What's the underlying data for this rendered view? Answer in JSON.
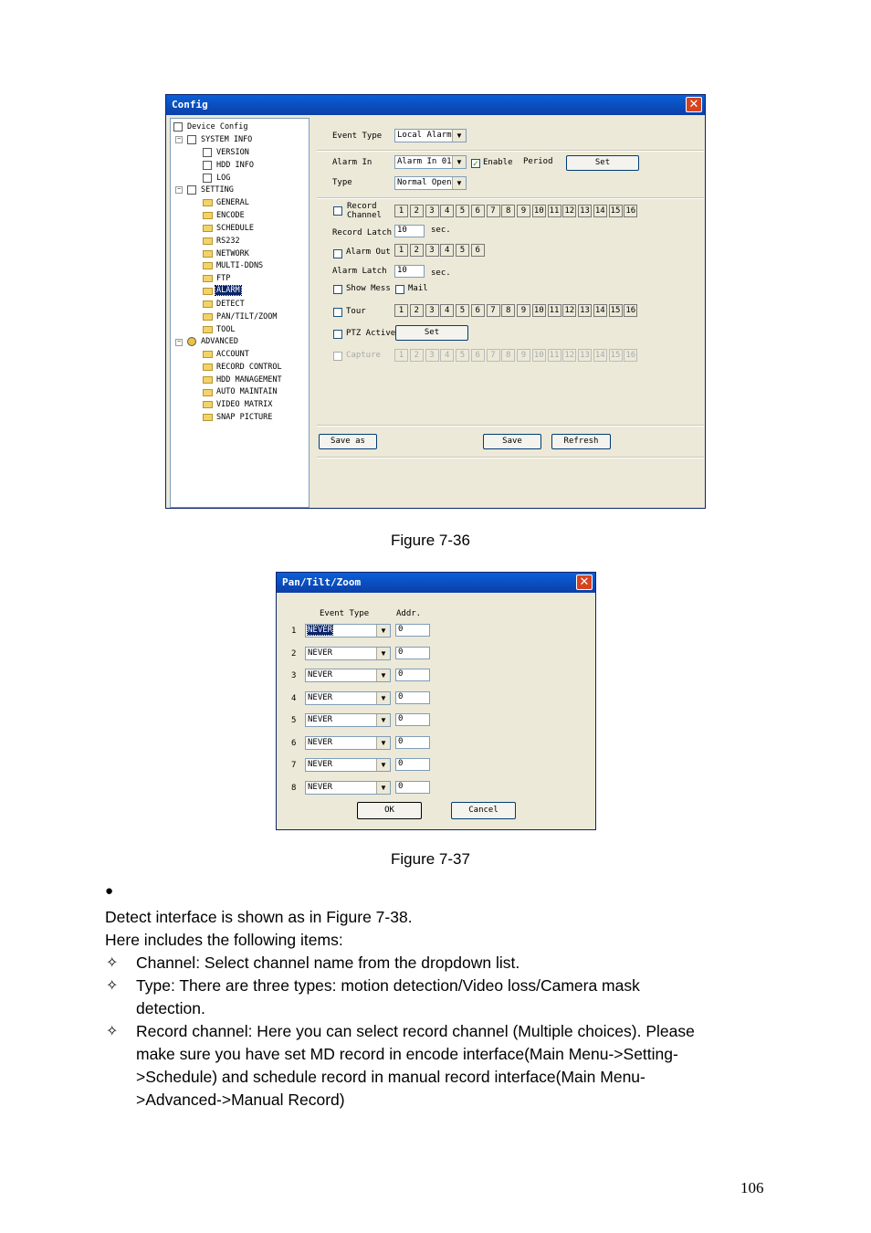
{
  "config_window": {
    "title": "Config",
    "tree_root": "Device Config",
    "tree": {
      "system_info": "SYSTEM INFO",
      "version": "VERSION",
      "hdd_info": "HDD INFO",
      "log": "LOG",
      "setting": "SETTING",
      "general": "GENERAL",
      "encode": "ENCODE",
      "schedule": "SCHEDULE",
      "rs232": "RS232",
      "network": "NETWORK",
      "multi_ddns": "MULTI-DDNS",
      "ftp": "FTP",
      "alarm": "ALARM",
      "detect": "DETECT",
      "ptz": "PAN/TILT/ZOOM",
      "tool": "TOOL",
      "advanced": "ADVANCED",
      "account": "ACCOUNT",
      "record_control": "RECORD CONTROL",
      "hdd_management": "HDD MANAGEMENT",
      "auto_maintain": "AUTO MAINTAIN",
      "video_matrix": "VIDEO MATRIX",
      "snap_picture": "SNAP PICTURE"
    },
    "event_type_label": "Event Type",
    "event_type_value": "Local Alarm",
    "alarm_in_label": "Alarm In",
    "alarm_in_value": "Alarm In 01",
    "enable_label": "Enable",
    "period_label": "Period",
    "set_label": "Set",
    "type_label": "Type",
    "type_value": "Normal Open",
    "record_channel_label_1": "Record",
    "record_channel_label_2": "Channel",
    "record_latch_label": "Record Latch",
    "record_latch_value": "10",
    "sec_label": "sec.",
    "alarm_out_label": "Alarm Out",
    "alarm_latch_label": "Alarm Latch",
    "alarm_latch_value": "10",
    "sec_label_2": "sec.",
    "show_mess_label": "Show Mess",
    "mail_label": "Mail",
    "tour_label": "Tour",
    "ptz_active_label": "PTZ Active",
    "ptz_set_label": "Set",
    "capture_label": "Capture",
    "channels16": [
      "1",
      "2",
      "3",
      "4",
      "5",
      "6",
      "7",
      "8",
      "9",
      "10",
      "11",
      "12",
      "13",
      "14",
      "15",
      "16"
    ],
    "channels6": [
      "1",
      "2",
      "3",
      "4",
      "5",
      "6"
    ],
    "save_as_label": "Save as",
    "save_label": "Save",
    "refresh_label": "Refresh"
  },
  "caption1": "Figure 7-36",
  "ptz_window": {
    "title": "Pan/Tilt/Zoom",
    "event_type_header": "Event Type",
    "addr_header": "Addr.",
    "rows": [
      {
        "n": "1",
        "event": "NEVER",
        "addr": "0"
      },
      {
        "n": "2",
        "event": "NEVER",
        "addr": "0"
      },
      {
        "n": "3",
        "event": "NEVER",
        "addr": "0"
      },
      {
        "n": "4",
        "event": "NEVER",
        "addr": "0"
      },
      {
        "n": "5",
        "event": "NEVER",
        "addr": "0"
      },
      {
        "n": "6",
        "event": "NEVER",
        "addr": "0"
      },
      {
        "n": "7",
        "event": "NEVER",
        "addr": "0"
      },
      {
        "n": "8",
        "event": "NEVER",
        "addr": "0"
      }
    ],
    "ok_label": "OK",
    "cancel_label": "Cancel"
  },
  "caption2": "Figure 7-37",
  "text": {
    "bullet": "●",
    "line1": "Detect interface is shown as in Figure 7-38.",
    "line2": "Here includes the following items:",
    "diamond": "✧",
    "item1": "Channel: Select channel name from the dropdown list.",
    "item2a": "Type: There are three types: motion detection/Video loss/Camera mask",
    "item2b": "detection.",
    "item3a": "Record channel: Here you can select record channel (Multiple choices). Please",
    "item3b": "make sure you have set MD record in encode interface(Main Menu->Setting-",
    "item3c": ">Schedule) and schedule record in manual record interface(Main Menu-",
    "item3d": ">Advanced->Manual Record)"
  },
  "page_number": "106"
}
